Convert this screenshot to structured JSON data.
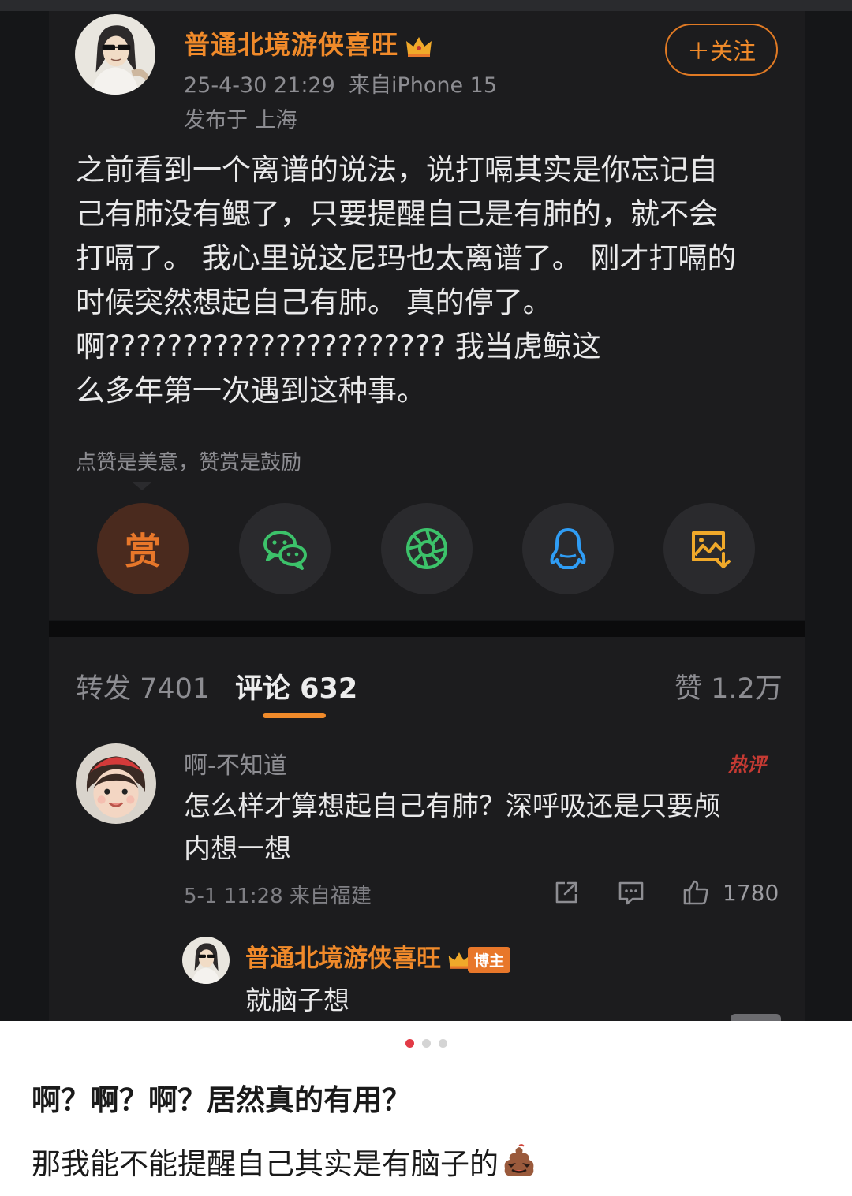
{
  "post": {
    "author": "普通北境游侠喜旺",
    "timestamp": "25-4-30 21:29",
    "device": "来自iPhone 15",
    "location": "发布于 上海",
    "follow_label": "＋关注",
    "body_lines": [
      "之前看到一个离谱的说法，说打嗝其实是你忘记自",
      "己有肺没有鳃了，只要提醒自己是有肺的，就不会",
      "打嗝了。 我心里说这尼玛也太离谱了。 刚才打嗝的",
      "时候突然想起自己有肺。 真的停了。",
      "啊?????????????????????? 我当虎鲸这",
      "么多年第一次遇到这种事。"
    ],
    "reward_tip": "点赞是美意，赞赏是鼓励",
    "share_buttons": [
      {
        "label": "赏",
        "icon": "reward-icon",
        "color": "#e8772a"
      },
      {
        "label": "",
        "icon": "wechat-icon",
        "color": "#3cc26a"
      },
      {
        "label": "",
        "icon": "moments-icon",
        "color": "#3cc26a"
      },
      {
        "label": "",
        "icon": "qq-icon",
        "color": "#2f9df5"
      },
      {
        "label": "",
        "icon": "save-image-icon",
        "color": "#f0a92a"
      }
    ]
  },
  "stats": {
    "repost": "转发 7401",
    "comments": "评论 632",
    "likes": "赞 1.2万"
  },
  "comment": {
    "user": "啊-不知道",
    "badge": "热评",
    "text_lines": [
      "怎么样才算想起自己有肺？深呼吸还是只要颅",
      "内想一想"
    ],
    "meta": "5-1 11:28 来自福建",
    "like_count": "1780",
    "actions": [
      "share-icon",
      "reply-icon",
      "thumbs-up-icon"
    ]
  },
  "reply": {
    "user": "普通北境游侠喜旺",
    "badge": "博主",
    "text": "就脑子想"
  },
  "carousel": {
    "count": 3,
    "active_index": 0
  },
  "caption": {
    "line1": "啊？啊？啊？居然真的有用？",
    "line2": "那我能不能提醒自己其实是有脑子的"
  },
  "colors": {
    "accent": "#f08a2a",
    "background": "#1c1c1e",
    "hot": "#c53a33",
    "dot_active": "#e23a46"
  }
}
